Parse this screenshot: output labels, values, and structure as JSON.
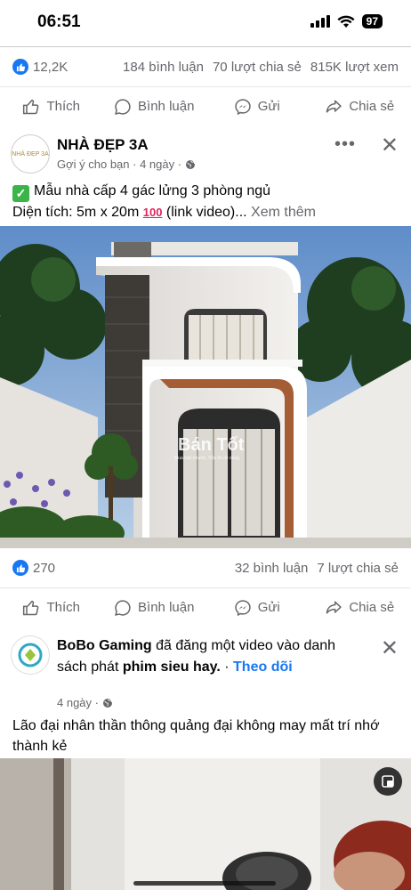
{
  "status": {
    "time": "06:51",
    "battery": "97"
  },
  "post1": {
    "likes": "12,2K",
    "comments": "184 bình luận",
    "shares": "70 lượt chia sẻ",
    "views": "815K lượt xem"
  },
  "actions": {
    "like": "Thích",
    "comment": "Bình luận",
    "send": "Gửi",
    "share": "Chia sẻ"
  },
  "post2": {
    "page_name": "NHÀ ĐẸP 3A",
    "avatar_text": "NHÀ ĐẸP 3A",
    "meta": "Gợi ý cho bạn · 4 ngày ·",
    "line1": "Mẫu nhà cấp 4 gác lửng 3 phòng ngủ",
    "line2": "Diện tích: 5m x 20m",
    "emoji_100": "100",
    "line2_suffix": "(link video)...",
    "see_more": "Xem thêm",
    "watermark": "Bán Tốt",
    "watermark_sub": "Mua bán nhanh, Tiếp thị dễ dàng",
    "likes": "270",
    "comments": "32 bình luận",
    "shares": "7 lượt chia sẻ"
  },
  "post3": {
    "author": "BoBo Gaming",
    "action_text": "đã đăng một video vào danh sách phát",
    "playlist": "phim sieu hay.",
    "dot": "·",
    "follow": "Theo dõi",
    "meta": "4 ngày ·",
    "text": "Lão đại nhân thần thông quảng đại không may mất trí nhớ thành kẻ"
  },
  "colors": {
    "facebook_blue": "#1877f2",
    "secondary_text": "#65676b",
    "divider": "#c9ccd1"
  },
  "icons": [
    "like-icon",
    "comment-icon",
    "messenger-icon",
    "share-icon",
    "globe-icon",
    "close-icon",
    "more-icon",
    "fullscreen-icon"
  ]
}
